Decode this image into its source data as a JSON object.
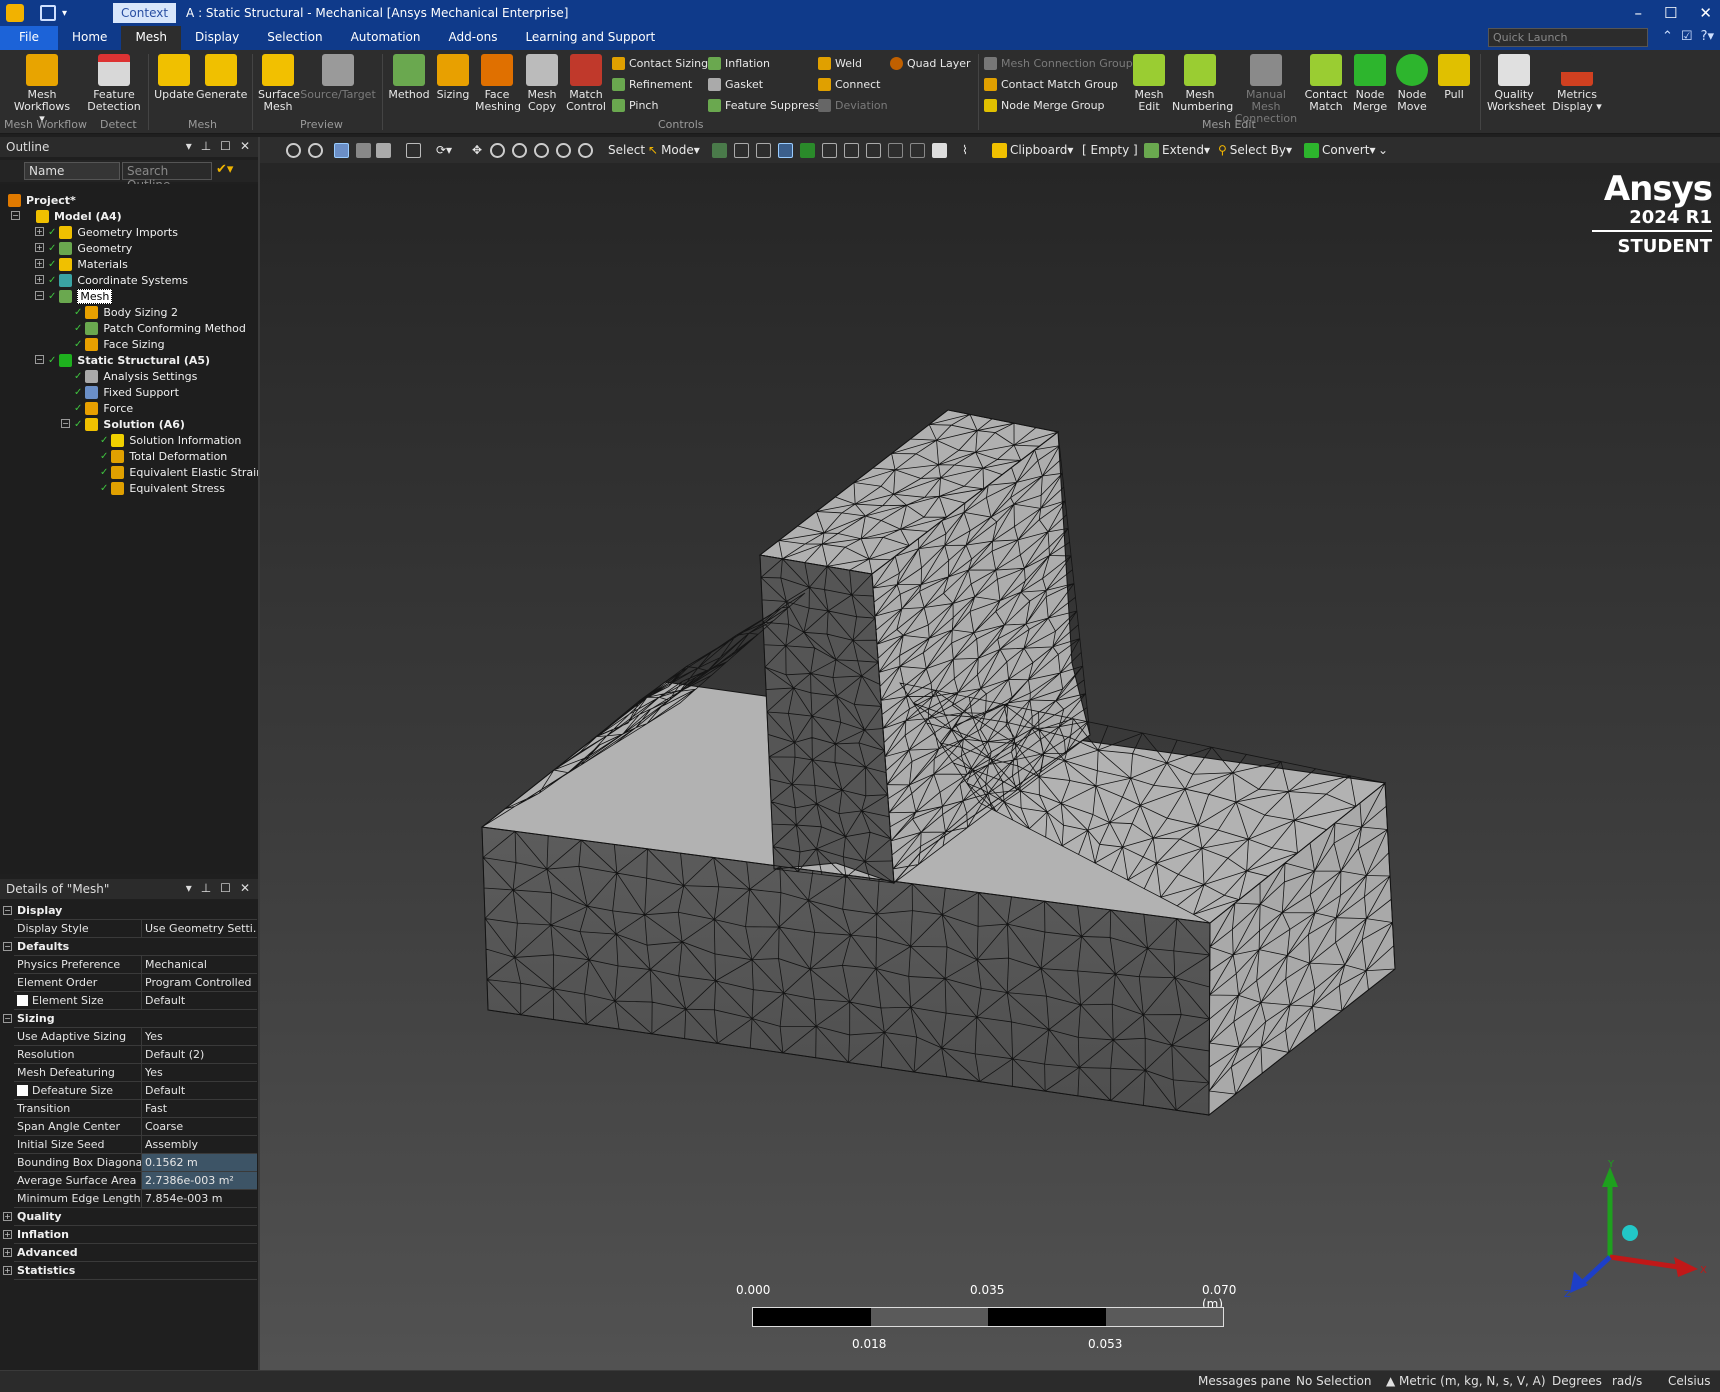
{
  "titlebar": {
    "context_tab": "Context",
    "title": "A : Static Structural - Mechanical [Ansys Mechanical Enterprise]",
    "minimize": "–",
    "maximize": "☐",
    "close": "✕"
  },
  "menu": {
    "tabs": [
      "File",
      "Home",
      "Mesh",
      "Display",
      "Selection",
      "Automation",
      "Add-ons",
      "Learning and Support"
    ],
    "active_tab": "Mesh",
    "quick_launch_placeholder": "Quick Launch"
  },
  "ribbon": {
    "mesh_workflows": "Mesh Workflows ▾",
    "feature_detection": "Feature Detection",
    "update": "Update",
    "generate": "Generate",
    "surface_mesh": "Surface Mesh",
    "source_target": "Source/Target",
    "method": "Method",
    "sizing": "Sizing",
    "face_meshing": "Face Meshing",
    "mesh_copy": "Mesh Copy",
    "match_control": "Match Control",
    "contact_sizing": "Contact Sizing",
    "refinement": "Refinement",
    "pinch": "Pinch",
    "inflation": "Inflation",
    "gasket": "Gasket",
    "feature_suppress": "Feature Suppress",
    "weld": "Weld",
    "connect": "Connect",
    "deviation": "Deviation",
    "quad_layer": "Quad Layer",
    "mesh_connection_group": "Mesh Connection Group",
    "contact_match_group": "Contact Match Group",
    "node_merge_group": "Node Merge Group",
    "mesh_edit": "Mesh Edit",
    "mesh_numbering": "Mesh Numbering",
    "manual_mesh_connection": "Manual Mesh Connection",
    "contact_match": "Contact Match",
    "node_merge": "Node Merge",
    "node_move": "Node Move",
    "pull": "Pull",
    "quality_worksheet": "Quality Worksheet",
    "metrics_display": "Metrics Display ▾",
    "groups": {
      "mesh_workflow": "Mesh Workflow",
      "detect": "Detect",
      "mesh": "Mesh",
      "preview": "Preview",
      "controls": "Controls",
      "mesh_edit": "Mesh Edit"
    }
  },
  "outline": {
    "title": "Outline",
    "filter_name": "Name",
    "search_placeholder": "Search Outline",
    "items": [
      {
        "label": "Project*"
      },
      {
        "label": "Model (A4)"
      },
      {
        "label": "Geometry Imports"
      },
      {
        "label": "Geometry"
      },
      {
        "label": "Materials"
      },
      {
        "label": "Coordinate Systems"
      },
      {
        "label": "Mesh"
      },
      {
        "label": "Body Sizing 2"
      },
      {
        "label": "Patch Conforming Method"
      },
      {
        "label": "Face Sizing"
      },
      {
        "label": "Static Structural (A5)"
      },
      {
        "label": "Analysis Settings"
      },
      {
        "label": "Fixed Support"
      },
      {
        "label": "Force"
      },
      {
        "label": "Solution (A6)"
      },
      {
        "label": "Solution Information"
      },
      {
        "label": "Total Deformation"
      },
      {
        "label": "Equivalent Elastic Strain"
      },
      {
        "label": "Equivalent Stress"
      }
    ]
  },
  "details": {
    "title": "Details of \"Mesh\"",
    "display": {
      "cat": "Display",
      "rows": [
        {
          "k": "Display Style",
          "v": "Use Geometry Setti..."
        }
      ]
    },
    "defaults": {
      "cat": "Defaults",
      "rows": [
        {
          "k": "Physics Preference",
          "v": "Mechanical"
        },
        {
          "k": "Element Order",
          "v": "Program Controlled"
        },
        {
          "k": "Element Size",
          "v": "Default"
        }
      ]
    },
    "sizing": {
      "cat": "Sizing",
      "rows": [
        {
          "k": "Use Adaptive Sizing",
          "v": "Yes"
        },
        {
          "k": "Resolution",
          "v": "Default (2)"
        },
        {
          "k": "Mesh Defeaturing",
          "v": "Yes"
        },
        {
          "k": "Defeature Size",
          "v": "Default"
        },
        {
          "k": "Transition",
          "v": "Fast"
        },
        {
          "k": "Span Angle Center",
          "v": "Coarse"
        },
        {
          "k": "Initial Size Seed",
          "v": "Assembly"
        },
        {
          "k": "Bounding Box Diagonal",
          "v": "0.1562 m"
        },
        {
          "k": "Average Surface Area",
          "v": "2.7386e-003 m²"
        },
        {
          "k": "Minimum Edge Length",
          "v": "7.854e-003 m"
        }
      ]
    },
    "collapsed": [
      "Quality",
      "Inflation",
      "Advanced",
      "Statistics"
    ]
  },
  "graphics_toolbar": {
    "select": "Select",
    "mode": "Mode▾",
    "clipboard": "Clipboard▾",
    "empty": "[ Empty ]",
    "extend": "Extend▾",
    "select_by": "Select By▾",
    "convert": "Convert▾"
  },
  "viewport": {
    "logo": {
      "brand": "Ansys",
      "version": "2024 R1",
      "edition": "STUDENT"
    },
    "scale": {
      "top_labels": [
        "0.000",
        "0.035",
        "0.070 (m)"
      ],
      "bottom_labels": [
        "0.018",
        "0.053"
      ]
    },
    "triad": {
      "y": "Y",
      "x": "X",
      "z": "Z"
    }
  },
  "statusbar": {
    "messages": "Messages pane",
    "selection": "No Selection",
    "units": "▲ Metric (m, kg, N, s, V, A)",
    "angle": "Degrees",
    "rot": "rad/s",
    "temp": "Celsius"
  },
  "colors": {
    "title_blue": "#0f3a8a",
    "file_blue": "#1c63d8",
    "mesh_face": "#b4b4b4",
    "mesh_dark": "#5a5a5a"
  }
}
